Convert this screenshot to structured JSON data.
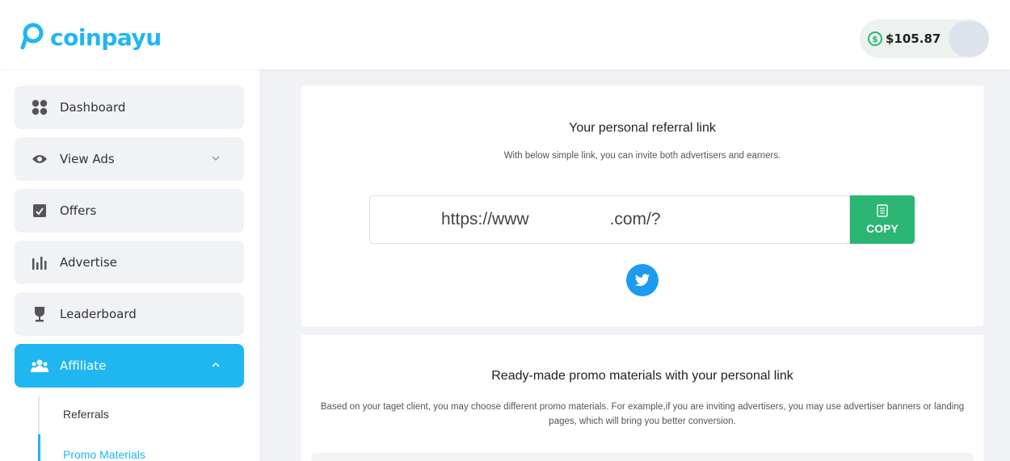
{
  "header": {
    "logo_text": "coinpayu",
    "balance": "$105.87",
    "balance_icon": "dollar-circle-icon"
  },
  "sidebar": {
    "items": [
      {
        "label": "Dashboard",
        "icon": "dashboard-grid-icon"
      },
      {
        "label": "View Ads",
        "icon": "eye-icon"
      },
      {
        "label": "Offers",
        "icon": "offer-check-icon"
      },
      {
        "label": "Advertise",
        "icon": "bar-chart-icon"
      },
      {
        "label": "Leaderboard",
        "icon": "trophy-icon"
      },
      {
        "label": "Affiliate",
        "icon": "users-icon"
      }
    ],
    "sub_items": [
      {
        "label": "Referrals"
      },
      {
        "label": "Promo Materials"
      }
    ]
  },
  "referral": {
    "title": "Your personal referral link",
    "subtitle": "With below simple link, you can invite both advertisers and earners.",
    "link_start": "https://www",
    "link_end": ".com/?",
    "copy_label": "COPY"
  },
  "promo": {
    "title": "Ready-made promo materials with your personal link",
    "text": "Based on your taget client, you may choose different promo materials. For example,if you are inviting advertisers, you may use advertiser banners or landing pages, which will bring you better conversion."
  },
  "colors": {
    "accent": "#1fb6f2",
    "copy_button": "#2bb673",
    "twitter": "#1d9bf0"
  }
}
